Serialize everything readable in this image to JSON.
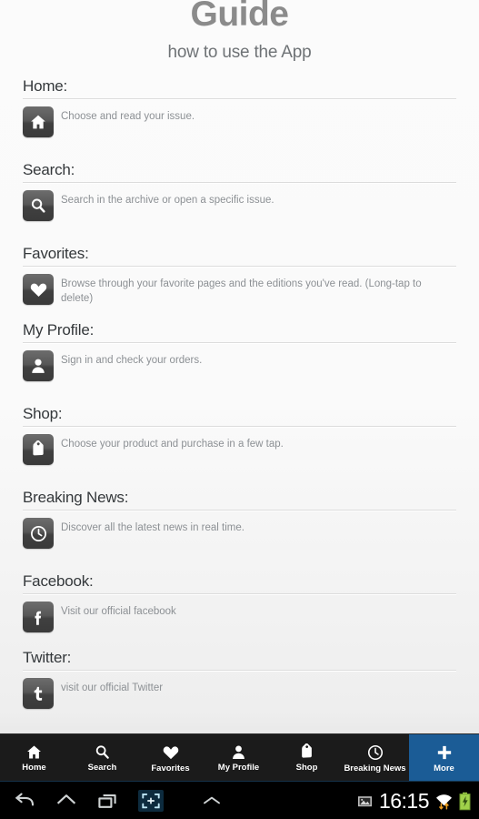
{
  "header": {
    "title": "Guide",
    "subtitle": "how to use the App"
  },
  "sections": [
    {
      "heading": "Home:",
      "icon": "home-icon",
      "description": "Choose and read your issue."
    },
    {
      "heading": "Search:",
      "icon": "search-icon",
      "description": "Search in the archive or open a specific issue."
    },
    {
      "heading": "Favorites:",
      "icon": "heart-icon",
      "description": "Browse through your favorite pages and the editions you've read. (Long-tap to delete)"
    },
    {
      "heading": "My Profile:",
      "icon": "person-icon",
      "description": "Sign in and check your orders."
    },
    {
      "heading": "Shop:",
      "icon": "tag-icon",
      "description": "Choose your product and purchase in a few tap."
    },
    {
      "heading": "Breaking News:",
      "icon": "clock-icon",
      "description": "Discover all the latest news in real time."
    },
    {
      "heading": "Facebook:",
      "icon": "facebook-icon",
      "description": "Visit our official facebook"
    },
    {
      "heading": "Twitter:",
      "icon": "twitter-icon",
      "description": "visit our official Twitter"
    }
  ],
  "tabbar": {
    "accent_color": "#1b5c96",
    "tabs": [
      {
        "label": "Home",
        "icon": "home-icon",
        "selected": false
      },
      {
        "label": "Search",
        "icon": "search-icon",
        "selected": false
      },
      {
        "label": "Favorites",
        "icon": "heart-icon",
        "selected": false
      },
      {
        "label": "My Profile",
        "icon": "person-icon",
        "selected": false
      },
      {
        "label": "Shop",
        "icon": "tag-icon",
        "selected": false
      },
      {
        "label": "Breaking News",
        "icon": "clock-icon",
        "selected": false
      },
      {
        "label": "More",
        "icon": "plus-icon",
        "selected": true
      }
    ]
  },
  "system_bar": {
    "back": "back-icon",
    "home": "home-icon",
    "recents": "recents-icon",
    "capture": "screenshot-icon",
    "expand": "chevron-up-icon",
    "image_status": "image-icon",
    "clock": "16:15",
    "wifi": "wifi-icon",
    "battery": "battery-charging-icon"
  }
}
